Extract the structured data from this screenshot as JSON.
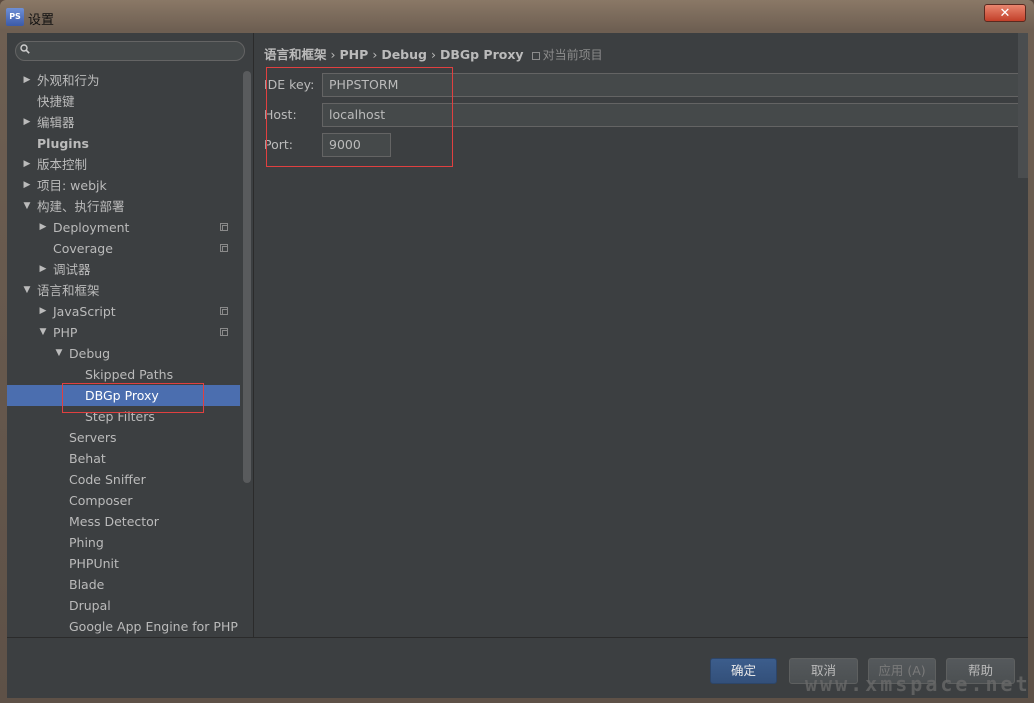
{
  "window": {
    "title": "设置",
    "close_glyph": "✕"
  },
  "sidebar": {
    "search_placeholder": "",
    "tree": [
      {
        "label": "外观和行为",
        "arrow": "▶",
        "level": 0,
        "bold": false,
        "copy": false
      },
      {
        "label": "快捷键",
        "arrow": "",
        "level": 0,
        "bold": false,
        "copy": false
      },
      {
        "label": "编辑器",
        "arrow": "▶",
        "level": 0,
        "bold": false,
        "copy": false
      },
      {
        "label": "Plugins",
        "arrow": "",
        "level": 0,
        "bold": true,
        "copy": false
      },
      {
        "label": "版本控制",
        "arrow": "▶",
        "level": 0,
        "bold": false,
        "copy": false
      },
      {
        "label": "项目: webjk",
        "arrow": "▶",
        "level": 0,
        "bold": false,
        "copy": false
      },
      {
        "label": "构建、执行部署",
        "arrow": "▼",
        "level": 0,
        "bold": false,
        "copy": false
      },
      {
        "label": "Deployment",
        "arrow": "▶",
        "level": 1,
        "bold": false,
        "copy": true
      },
      {
        "label": "Coverage",
        "arrow": "",
        "level": 1,
        "bold": false,
        "copy": true
      },
      {
        "label": "调试器",
        "arrow": "▶",
        "level": 1,
        "bold": false,
        "copy": false
      },
      {
        "label": "语言和框架",
        "arrow": "▼",
        "level": 0,
        "bold": false,
        "copy": false
      },
      {
        "label": "JavaScript",
        "arrow": "▶",
        "level": 1,
        "bold": false,
        "copy": true
      },
      {
        "label": "PHP",
        "arrow": "▼",
        "level": 1,
        "bold": false,
        "copy": true
      },
      {
        "label": "Debug",
        "arrow": "▼",
        "level": 2,
        "bold": false,
        "copy": false
      },
      {
        "label": "Skipped Paths",
        "arrow": "",
        "level": 3,
        "bold": false,
        "copy": false
      },
      {
        "label": "DBGp Proxy",
        "arrow": "",
        "level": 3,
        "bold": false,
        "copy": false,
        "selected": true
      },
      {
        "label": "Step Filters",
        "arrow": "",
        "level": 3,
        "bold": false,
        "copy": false
      },
      {
        "label": "Servers",
        "arrow": "",
        "level": 2,
        "bold": false,
        "copy": false
      },
      {
        "label": "Behat",
        "arrow": "",
        "level": 2,
        "bold": false,
        "copy": false
      },
      {
        "label": "Code Sniffer",
        "arrow": "",
        "level": 2,
        "bold": false,
        "copy": false
      },
      {
        "label": "Composer",
        "arrow": "",
        "level": 2,
        "bold": false,
        "copy": false
      },
      {
        "label": "Mess Detector",
        "arrow": "",
        "level": 2,
        "bold": false,
        "copy": false
      },
      {
        "label": "Phing",
        "arrow": "",
        "level": 2,
        "bold": false,
        "copy": false
      },
      {
        "label": "PHPUnit",
        "arrow": "",
        "level": 2,
        "bold": false,
        "copy": false
      },
      {
        "label": "Blade",
        "arrow": "",
        "level": 2,
        "bold": false,
        "copy": false
      },
      {
        "label": "Drupal",
        "arrow": "",
        "level": 2,
        "bold": false,
        "copy": false
      },
      {
        "label": "Google App Engine for PHP",
        "arrow": "",
        "level": 2,
        "bold": false,
        "copy": false
      }
    ]
  },
  "breadcrumb": {
    "items": [
      "语言和框架",
      "PHP",
      "Debug",
      "DBGp Proxy"
    ],
    "separator": "›",
    "scope_note": "对当前项目"
  },
  "form": {
    "ide_key": {
      "label": "IDE key:",
      "value": "PHPSTORM"
    },
    "host": {
      "label": "Host:",
      "value": "localhost"
    },
    "port": {
      "label": "Port:",
      "value": "9000"
    }
  },
  "buttons": {
    "ok": "确定",
    "cancel": "取消",
    "apply": "应用 (A)",
    "help": "帮助"
  },
  "watermark": "www.xmspace.net",
  "colors": {
    "panel_bg": "#3c3f41",
    "selection": "#4b6eaf",
    "text": "#bbbbbb",
    "highlight_border": "#e04040"
  }
}
